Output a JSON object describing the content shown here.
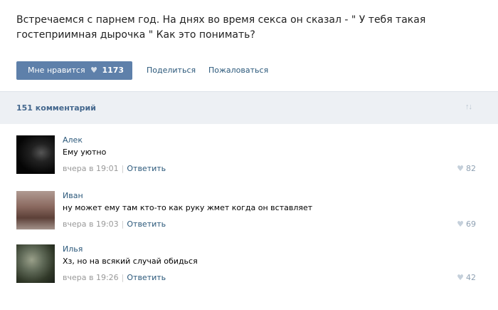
{
  "post": {
    "text": "Встречаемся с парнем год. На днях во время секса он сказал - \" У тебя такая гостеприимная дырочка \" Как это понимать?",
    "like_label": "Мне нравится",
    "like_count": "1173",
    "share_label": "Поделиться",
    "report_label": "Пожаловаться"
  },
  "comments_header": {
    "count_label": "151 комментарий",
    "sort_icon": "sort-icon"
  },
  "comments": [
    {
      "author": "Алек",
      "text": "Ему уютно",
      "time": "вчера в 19:01",
      "reply": "Ответить",
      "likes": "82"
    },
    {
      "author": "Иван",
      "text": "ну может ему там кто-то как руку жмет когда он вставляет",
      "time": "вчера в 19:03",
      "reply": "Ответить",
      "likes": "69"
    },
    {
      "author": "Илья",
      "text": "Хз, но на всякий случай обидься",
      "time": "вчера в 19:26",
      "reply": "Ответить",
      "likes": "42"
    }
  ],
  "colors": {
    "accent": "#5e80aa",
    "link": "#2b587a",
    "header_bg": "#edf0f4"
  }
}
